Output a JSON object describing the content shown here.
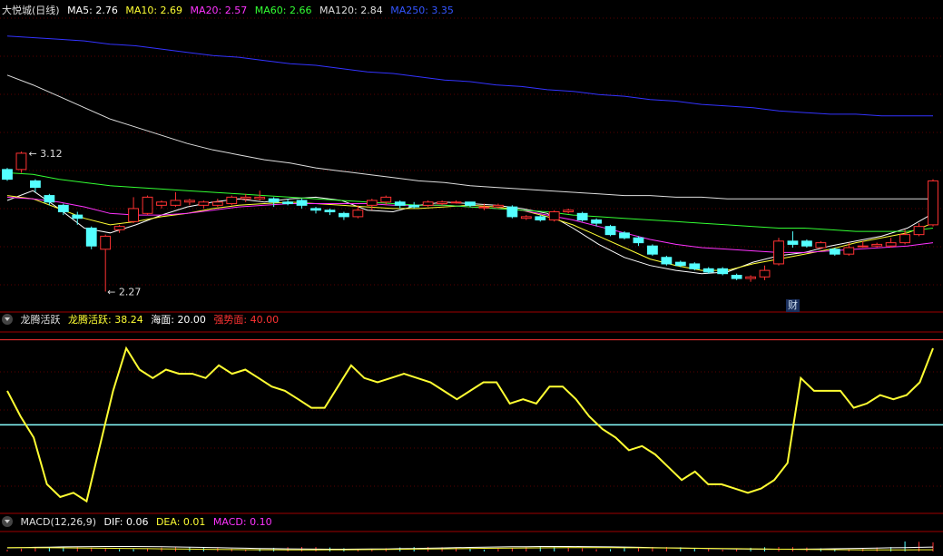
{
  "main": {
    "title": "大悦城(日线)",
    "ma": [
      {
        "label": "MA5:",
        "value": "2.76",
        "color": "#ffffff"
      },
      {
        "label": "MA10:",
        "value": "2.69",
        "color": "#ffff33"
      },
      {
        "label": "MA20:",
        "value": "2.57",
        "color": "#ff33ff"
      },
      {
        "label": "MA60:",
        "value": "2.66",
        "color": "#33ff33"
      },
      {
        "label": "MA120:",
        "value": "2.84",
        "color": "#dddddd"
      },
      {
        "label": "MA250:",
        "value": "3.35",
        "color": "#3333ff"
      }
    ],
    "high_label": "3.12",
    "low_label": "2.27",
    "marker": "财"
  },
  "indicator": {
    "name": "龙腾活跃",
    "items": [
      {
        "label": "龙腾活跃:",
        "value": "38.24",
        "color": "#ffff33"
      },
      {
        "label": "海面:",
        "value": "20.00",
        "color": "#ffffff"
      },
      {
        "label": "强势面:",
        "value": "40.00",
        "color": "#ff3333"
      }
    ]
  },
  "macd": {
    "name": "MACD(12,26,9)",
    "items": [
      {
        "label": "DIF:",
        "value": "0.06",
        "color": "#ffffff"
      },
      {
        "label": "DEA:",
        "value": "0.01",
        "color": "#ffff33"
      },
      {
        "label": "MACD:",
        "value": "0.10",
        "color": "#ff33ff"
      }
    ]
  },
  "chart_data": [
    {
      "type": "candlestick",
      "title": "大悦城(日线)",
      "candles": [
        [
          3.02,
          2.96,
          3.03,
          2.95
        ],
        [
          3.02,
          3.12,
          3.13,
          3.0
        ],
        [
          2.95,
          2.91,
          2.96,
          2.88
        ],
        [
          2.86,
          2.82,
          2.87,
          2.8
        ],
        [
          2.8,
          2.76,
          2.81,
          2.74
        ],
        [
          2.74,
          2.72,
          2.76,
          2.68
        ],
        [
          2.66,
          2.55,
          2.67,
          2.53
        ],
        [
          2.53,
          2.61,
          2.62,
          2.27
        ],
        [
          2.65,
          2.67,
          2.68,
          2.63
        ],
        [
          2.7,
          2.78,
          2.85,
          2.69
        ],
        [
          2.75,
          2.85,
          2.86,
          2.74
        ],
        [
          2.8,
          2.82,
          2.83,
          2.78
        ],
        [
          2.8,
          2.83,
          2.88,
          2.79
        ],
        [
          2.82,
          2.83,
          2.84,
          2.8
        ],
        [
          2.8,
          2.82,
          2.83,
          2.78
        ],
        [
          2.8,
          2.82,
          2.84,
          2.79
        ],
        [
          2.81,
          2.85,
          2.86,
          2.8
        ],
        [
          2.84,
          2.85,
          2.87,
          2.82
        ],
        [
          2.84,
          2.85,
          2.89,
          2.83
        ],
        [
          2.84,
          2.82,
          2.85,
          2.79
        ],
        [
          2.82,
          2.81,
          2.84,
          2.8
        ],
        [
          2.83,
          2.8,
          2.84,
          2.78
        ],
        [
          2.78,
          2.77,
          2.79,
          2.75
        ],
        [
          2.77,
          2.76,
          2.78,
          2.74
        ],
        [
          2.75,
          2.73,
          2.76,
          2.71
        ],
        [
          2.73,
          2.77,
          2.8,
          2.72
        ],
        [
          2.8,
          2.83,
          2.84,
          2.77
        ],
        [
          2.82,
          2.85,
          2.86,
          2.8
        ],
        [
          2.82,
          2.8,
          2.83,
          2.78
        ],
        [
          2.8,
          2.79,
          2.82,
          2.78
        ],
        [
          2.8,
          2.82,
          2.83,
          2.79
        ],
        [
          2.81,
          2.82,
          2.83,
          2.8
        ],
        [
          2.82,
          2.82,
          2.83,
          2.81
        ],
        [
          2.82,
          2.8,
          2.82,
          2.79
        ],
        [
          2.79,
          2.79,
          2.81,
          2.77
        ],
        [
          2.79,
          2.8,
          2.81,
          2.78
        ],
        [
          2.79,
          2.73,
          2.8,
          2.72
        ],
        [
          2.72,
          2.73,
          2.74,
          2.71
        ],
        [
          2.73,
          2.71,
          2.74,
          2.7
        ],
        [
          2.71,
          2.76,
          2.77,
          2.7
        ],
        [
          2.76,
          2.77,
          2.78,
          2.75
        ],
        [
          2.75,
          2.71,
          2.76,
          2.7
        ],
        [
          2.71,
          2.69,
          2.72,
          2.67
        ],
        [
          2.67,
          2.62,
          2.68,
          2.61
        ],
        [
          2.63,
          2.6,
          2.64,
          2.59
        ],
        [
          2.6,
          2.57,
          2.61,
          2.55
        ],
        [
          2.55,
          2.5,
          2.56,
          2.49
        ],
        [
          2.48,
          2.44,
          2.49,
          2.43
        ],
        [
          2.45,
          2.43,
          2.46,
          2.42
        ],
        [
          2.44,
          2.41,
          2.45,
          2.4
        ],
        [
          2.41,
          2.39,
          2.42,
          2.38
        ],
        [
          2.41,
          2.38,
          2.42,
          2.37
        ],
        [
          2.37,
          2.35,
          2.38,
          2.34
        ],
        [
          2.35,
          2.36,
          2.37,
          2.33
        ],
        [
          2.36,
          2.4,
          2.43,
          2.34
        ],
        [
          2.44,
          2.58,
          2.6,
          2.43
        ],
        [
          2.58,
          2.56,
          2.64,
          2.54
        ],
        [
          2.58,
          2.55,
          2.59,
          2.54
        ],
        [
          2.54,
          2.57,
          2.58,
          2.53
        ],
        [
          2.53,
          2.5,
          2.54,
          2.49
        ],
        [
          2.5,
          2.54,
          2.57,
          2.49
        ],
        [
          2.55,
          2.55,
          2.58,
          2.54
        ],
        [
          2.55,
          2.56,
          2.57,
          2.54
        ],
        [
          2.55,
          2.57,
          2.6,
          2.54
        ],
        [
          2.57,
          2.62,
          2.65,
          2.56
        ],
        [
          2.62,
          2.67,
          2.69,
          2.61
        ],
        [
          2.68,
          2.95,
          2.96,
          2.67
        ]
      ],
      "ma": {
        "MA5": [
          2.83,
          2.89,
          2.78,
          2.66,
          2.63,
          2.68,
          2.74,
          2.79,
          2.82,
          2.84,
          2.82,
          2.84,
          2.85,
          2.83,
          2.77,
          2.76,
          2.8,
          2.82,
          2.81,
          2.8,
          2.78,
          2.75,
          2.66,
          2.56,
          2.48,
          2.43,
          2.4,
          2.38,
          2.39,
          2.45,
          2.49,
          2.51,
          2.55,
          2.58,
          2.61,
          2.66,
          2.75
        ],
        "MA10": [
          2.86,
          2.84,
          2.78,
          2.72,
          2.68,
          2.7,
          2.73,
          2.75,
          2.78,
          2.8,
          2.81,
          2.82,
          2.81,
          2.8,
          2.79,
          2.78,
          2.78,
          2.79,
          2.8,
          2.79,
          2.77,
          2.73,
          2.68,
          2.61,
          2.54,
          2.47,
          2.43,
          2.4,
          2.4,
          2.44,
          2.47,
          2.5,
          2.53,
          2.57,
          2.6,
          2.63,
          2.69
        ],
        "MA20": [
          2.85,
          2.84,
          2.82,
          2.79,
          2.75,
          2.74,
          2.74,
          2.75,
          2.77,
          2.79,
          2.8,
          2.81,
          2.81,
          2.81,
          2.81,
          2.8,
          2.8,
          2.8,
          2.79,
          2.78,
          2.77,
          2.74,
          2.71,
          2.67,
          2.63,
          2.59,
          2.56,
          2.54,
          2.53,
          2.52,
          2.51,
          2.51,
          2.52,
          2.53,
          2.54,
          2.55,
          2.57
        ],
        "MA60": [
          3.0,
          2.99,
          2.96,
          2.94,
          2.92,
          2.91,
          2.9,
          2.89,
          2.88,
          2.87,
          2.86,
          2.85,
          2.84,
          2.83,
          2.82,
          2.81,
          2.8,
          2.8,
          2.79,
          2.78,
          2.77,
          2.76,
          2.74,
          2.73,
          2.72,
          2.71,
          2.7,
          2.69,
          2.68,
          2.67,
          2.66,
          2.66,
          2.65,
          2.64,
          2.64,
          2.64,
          2.66
        ],
        "MA120": [
          3.6,
          3.54,
          3.47,
          3.4,
          3.33,
          3.28,
          3.23,
          3.18,
          3.14,
          3.11,
          3.08,
          3.06,
          3.03,
          3.01,
          2.99,
          2.97,
          2.95,
          2.94,
          2.92,
          2.91,
          2.9,
          2.89,
          2.88,
          2.87,
          2.86,
          2.86,
          2.85,
          2.85,
          2.84,
          2.84,
          2.84,
          2.84,
          2.84,
          2.84,
          2.84,
          2.84,
          2.84
        ],
        "MA250": [
          3.84,
          3.83,
          3.82,
          3.81,
          3.79,
          3.78,
          3.76,
          3.74,
          3.72,
          3.71,
          3.69,
          3.67,
          3.66,
          3.64,
          3.62,
          3.61,
          3.59,
          3.57,
          3.56,
          3.54,
          3.53,
          3.51,
          3.5,
          3.48,
          3.47,
          3.45,
          3.44,
          3.42,
          3.41,
          3.4,
          3.38,
          3.37,
          3.36,
          3.36,
          3.35,
          3.35,
          3.35
        ]
      },
      "ylim": [
        2.2,
        3.95
      ],
      "high": 3.12,
      "low": 2.27
    },
    {
      "type": "line",
      "series": [
        {
          "name": "龙腾活跃",
          "values": [
            28,
            22,
            17,
            6,
            3,
            4,
            2,
            15,
            28,
            38,
            33,
            31,
            33,
            32,
            32,
            31,
            34,
            32,
            33,
            31,
            29,
            28,
            26,
            24,
            24,
            29,
            34,
            31,
            30,
            31,
            32,
            31,
            30,
            28,
            26,
            28,
            30,
            30,
            25,
            26,
            25,
            29,
            29,
            26,
            22,
            19,
            17,
            14,
            15,
            13,
            10,
            7,
            9,
            6,
            6,
            5,
            4,
            5,
            7,
            11,
            31,
            28,
            28,
            28,
            24,
            25,
            27,
            26,
            27,
            30,
            38
          ]
        }
      ],
      "hlines": [
        {
          "name": "海面",
          "value": 20
        },
        {
          "name": "强势面",
          "value": 40
        }
      ],
      "ylim": [
        0,
        41
      ]
    },
    {
      "type": "macd",
      "series": [
        {
          "name": "DIF",
          "value": 0.06
        },
        {
          "name": "DEA",
          "value": 0.01
        },
        {
          "name": "MACD",
          "value": 0.1
        }
      ]
    }
  ]
}
